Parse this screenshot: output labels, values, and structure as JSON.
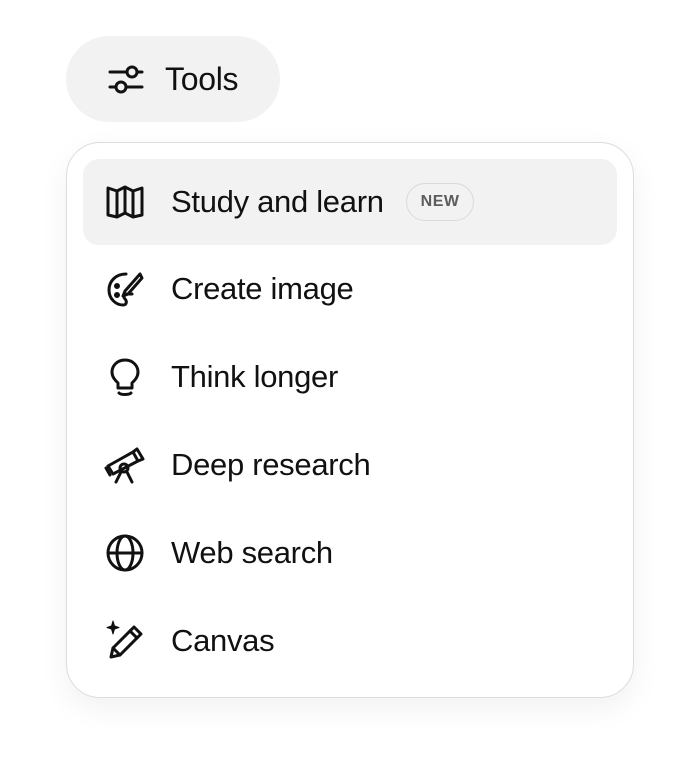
{
  "tools_button": {
    "label": "Tools",
    "icon": "sliders-icon"
  },
  "menu": {
    "items": [
      {
        "label": "Study and learn",
        "icon": "book-open-icon",
        "badge": "NEW",
        "active": true
      },
      {
        "label": "Create image",
        "icon": "palette-brush-icon",
        "active": false
      },
      {
        "label": "Think longer",
        "icon": "lightbulb-icon",
        "active": false
      },
      {
        "label": "Deep research",
        "icon": "telescope-icon",
        "active": false
      },
      {
        "label": "Web search",
        "icon": "globe-icon",
        "active": false
      },
      {
        "label": "Canvas",
        "icon": "sparkle-pencil-icon",
        "active": false
      }
    ]
  },
  "colors": {
    "hover_background": "#f2f2f2",
    "text": "#111111",
    "border": "#dcdcdc"
  }
}
